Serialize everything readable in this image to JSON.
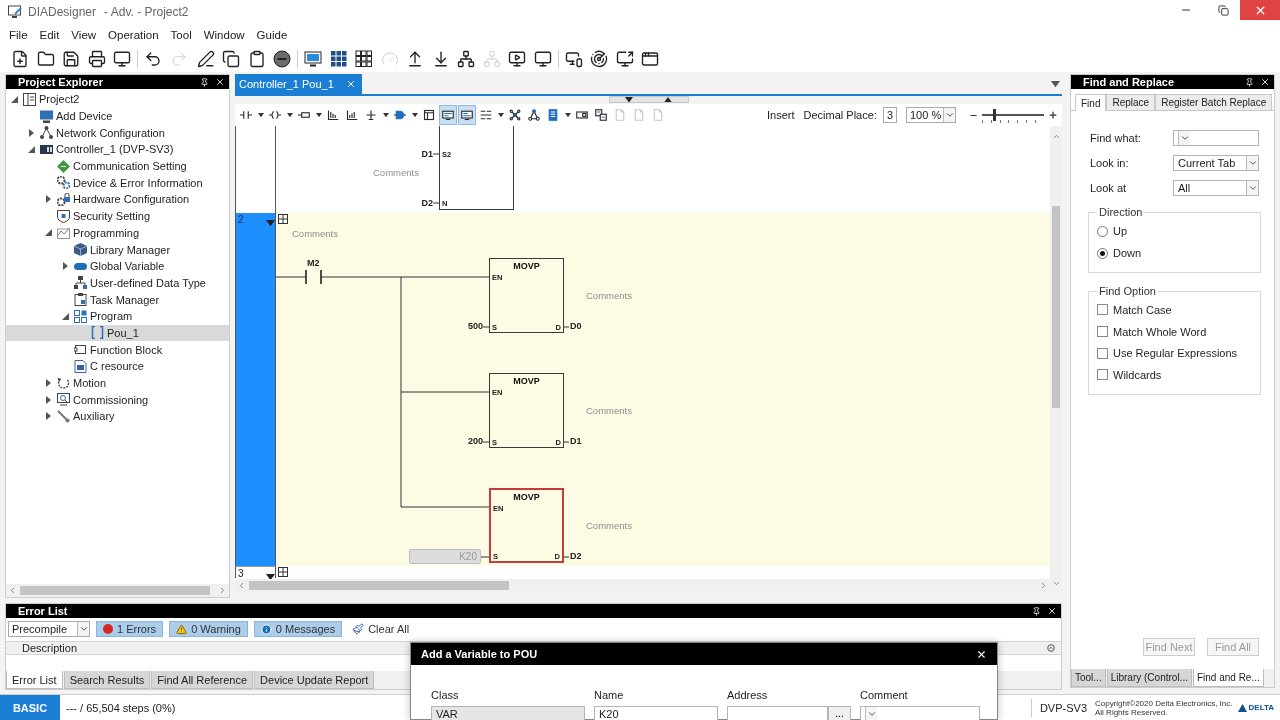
{
  "window": {
    "app_name": "DIADesigner",
    "title": "- Adv. - Project2"
  },
  "menu": [
    "File",
    "Edit",
    "View",
    "Operation",
    "Tool",
    "Window",
    "Guide"
  ],
  "toolbar": [
    {
      "disabled": false
    },
    {
      "disabled": false
    },
    {
      "disabled": false
    },
    {
      "disabled": false
    },
    {
      "disabled": false
    },
    {
      "disabled": false
    },
    {
      "disabled": true
    },
    {
      "disabled": false
    },
    {
      "disabled": false
    },
    {
      "disabled": false
    },
    {
      "disabled": false
    },
    {
      "disabled": false
    },
    {
      "disabled": false
    },
    {
      "disabled": false
    },
    {
      "disabled": true
    },
    {
      "disabled": false
    },
    {
      "disabled": false
    },
    {
      "disabled": false
    },
    {
      "disabled": true
    },
    {
      "disabled": false
    },
    {
      "disabled": false
    },
    {
      "disabled": false
    },
    {
      "disabled": false
    },
    {
      "disabled": false
    },
    {
      "disabled": false
    }
  ],
  "project_explorer": {
    "title": "Project Explorer",
    "tree": [
      {
        "label": "Project2",
        "expanded": true,
        "selected": false,
        "children": [
          {
            "label": "Add Device",
            "selected": false
          },
          {
            "label": "Network Configuration",
            "expanded": false,
            "selected": false
          },
          {
            "label": "Controller_1 (DVP-SV3)",
            "expanded": true,
            "selected": false,
            "children": [
              {
                "label": "Communication Setting",
                "selected": false
              },
              {
                "label": "Device & Error Information",
                "selected": false
              },
              {
                "label": "Hardware Configuration",
                "expanded": false,
                "selected": false
              },
              {
                "label": "Security Setting",
                "selected": false
              },
              {
                "label": "Programming",
                "expanded": true,
                "selected": false,
                "children": [
                  {
                    "label": "Library Manager",
                    "selected": false
                  },
                  {
                    "label": "Global Variable",
                    "expanded": false,
                    "selected": false
                  },
                  {
                    "label": "User-defined Data Type",
                    "selected": false
                  },
                  {
                    "label": "Task Manager",
                    "selected": false
                  },
                  {
                    "label": "Program",
                    "expanded": true,
                    "selected": false,
                    "children": [
                      {
                        "label": "Pou_1",
                        "selected": true
                      }
                    ]
                  },
                  {
                    "label": "Function Block",
                    "selected": false
                  },
                  {
                    "label": "C resource",
                    "selected": false
                  }
                ]
              },
              {
                "label": "Motion",
                "expanded": false,
                "selected": false
              },
              {
                "label": "Commissioning",
                "expanded": false,
                "selected": false
              },
              {
                "label": "Auxiliary",
                "expanded": false,
                "selected": false
              }
            ]
          }
        ]
      }
    ]
  },
  "editor": {
    "tabs": [
      {
        "label": "Controller_1 Pou_1",
        "selected": true
      }
    ],
    "ladder_toolbar": {
      "buttons": [
        {
          "pressed": false,
          "disabled": false
        },
        {
          "pressed": false,
          "disabled": false
        },
        {
          "pressed": false,
          "disabled": false
        },
        {
          "pressed": false,
          "disabled": false
        },
        {
          "pressed": false,
          "disabled": false
        },
        {
          "pressed": false,
          "disabled": false
        },
        {
          "pressed": false,
          "disabled": false
        },
        {
          "pressed": false,
          "disabled": false
        },
        {
          "pressed": true,
          "disabled": false
        },
        {
          "pressed": true,
          "disabled": false
        },
        {
          "pressed": false,
          "disabled": false
        },
        {
          "pressed": false,
          "disabled": false
        },
        {
          "pressed": false,
          "disabled": false
        },
        {
          "pressed": false,
          "disabled": false
        },
        {
          "pressed": false,
          "disabled": false
        },
        {
          "pressed": false,
          "disabled": false
        },
        {
          "pressed": false,
          "disabled": true
        },
        {
          "pressed": false,
          "disabled": true
        },
        {
          "pressed": false,
          "disabled": true
        }
      ],
      "mode": "Insert",
      "decimal_label": "Decimal Place:",
      "decimal_value": "3",
      "zoom": "100 %",
      "zoom_slider": {
        "level": 0.2
      }
    },
    "rungs": [
      {
        "selected": false,
        "comment": "Comments",
        "block": {
          "pins": [
            {
              "pin": "S2",
              "operand": "D1"
            },
            {
              "pin": "N",
              "operand": "D2"
            }
          ]
        }
      },
      {
        "number": "2",
        "selected": true,
        "comment": "Comments",
        "contact": "M2",
        "blocks": [
          {
            "name": "MOVP",
            "enable_pin": "EN",
            "source_pin": "S",
            "source": "500",
            "output_pin": "D",
            "output": "D0",
            "comment": "Comments",
            "selected": false,
            "editing": false
          },
          {
            "name": "MOVP",
            "enable_pin": "EN",
            "source_pin": "S",
            "source": "200",
            "output_pin": "D",
            "output": "D1",
            "comment": "Comments",
            "selected": false,
            "editing": false
          },
          {
            "name": "MOVP",
            "enable_pin": "EN",
            "source_pin": "S",
            "source": "K20",
            "output_pin": "D",
            "output": "D2",
            "comment": "Comments",
            "selected": true,
            "editing": true
          }
        ]
      },
      {
        "number": "3",
        "selected": false
      }
    ]
  },
  "find_and_replace": {
    "title": "Find and Replace",
    "tabs": [
      {
        "label": "Find",
        "selected": true
      },
      {
        "label": "Replace",
        "selected": false
      },
      {
        "label": "Register Batch Replace",
        "selected": false
      }
    ],
    "fields": [
      {
        "label": "Find what:"
      },
      {
        "label": "Look in:",
        "value": "Current Tab"
      },
      {
        "label": "Look at",
        "value": "All"
      }
    ],
    "direction": {
      "title": "Direction",
      "options": [
        {
          "label": "Up",
          "selected": false
        },
        {
          "label": "Down",
          "selected": true
        }
      ]
    },
    "find_option": {
      "title": "Find Option",
      "options": [
        {
          "label": "Match Case",
          "checked": false
        },
        {
          "label": "Match Whole Word",
          "checked": false
        },
        {
          "label": "Use Regular Expressions",
          "checked": false
        },
        {
          "label": "Wildcards",
          "checked": false
        }
      ]
    },
    "buttons": [
      {
        "label": "Find Next",
        "disabled": true
      },
      {
        "label": "Find All",
        "disabled": true
      }
    ],
    "bottom_tabs": [
      {
        "label": "Tool...",
        "selected": false
      },
      {
        "label": "Library (Control...",
        "selected": false
      },
      {
        "label": "Find and Re...",
        "selected": true
      }
    ]
  },
  "error_list": {
    "title": "Error List",
    "filter": "Precompile",
    "toggles": [
      {
        "kind": "error",
        "label": "1 Errors",
        "on": true
      },
      {
        "kind": "warning",
        "label": "0 Warning",
        "on": true
      },
      {
        "kind": "message",
        "label": "0 Messages",
        "on": true
      }
    ],
    "clear": "Clear All",
    "columns": [
      "Description"
    ],
    "tabs": [
      {
        "label": "Error List",
        "selected": true
      },
      {
        "label": "Search Results",
        "selected": false
      },
      {
        "label": "Find All Reference",
        "selected": false
      },
      {
        "label": "Device Update Report",
        "selected": false
      }
    ]
  },
  "status_bar": {
    "mode": "BASIC",
    "steps": "--- / 65,504 steps (0%)",
    "device": "DVP-SV3",
    "copyright": [
      "Copyright©2020 Delta Electronics, Inc.",
      "All Rights Reserved."
    ],
    "brand": "DELTA"
  },
  "dialog": {
    "title": "Add a Variable to POU",
    "fields": [
      {
        "kind": "readonly",
        "label": "Class",
        "value": "VAR"
      },
      {
        "kind": "text",
        "label": "Name",
        "value": "K20"
      },
      {
        "kind": "browse",
        "label": "Address",
        "button": "..."
      },
      {
        "kind": "combo",
        "label": "Comment"
      }
    ]
  }
}
